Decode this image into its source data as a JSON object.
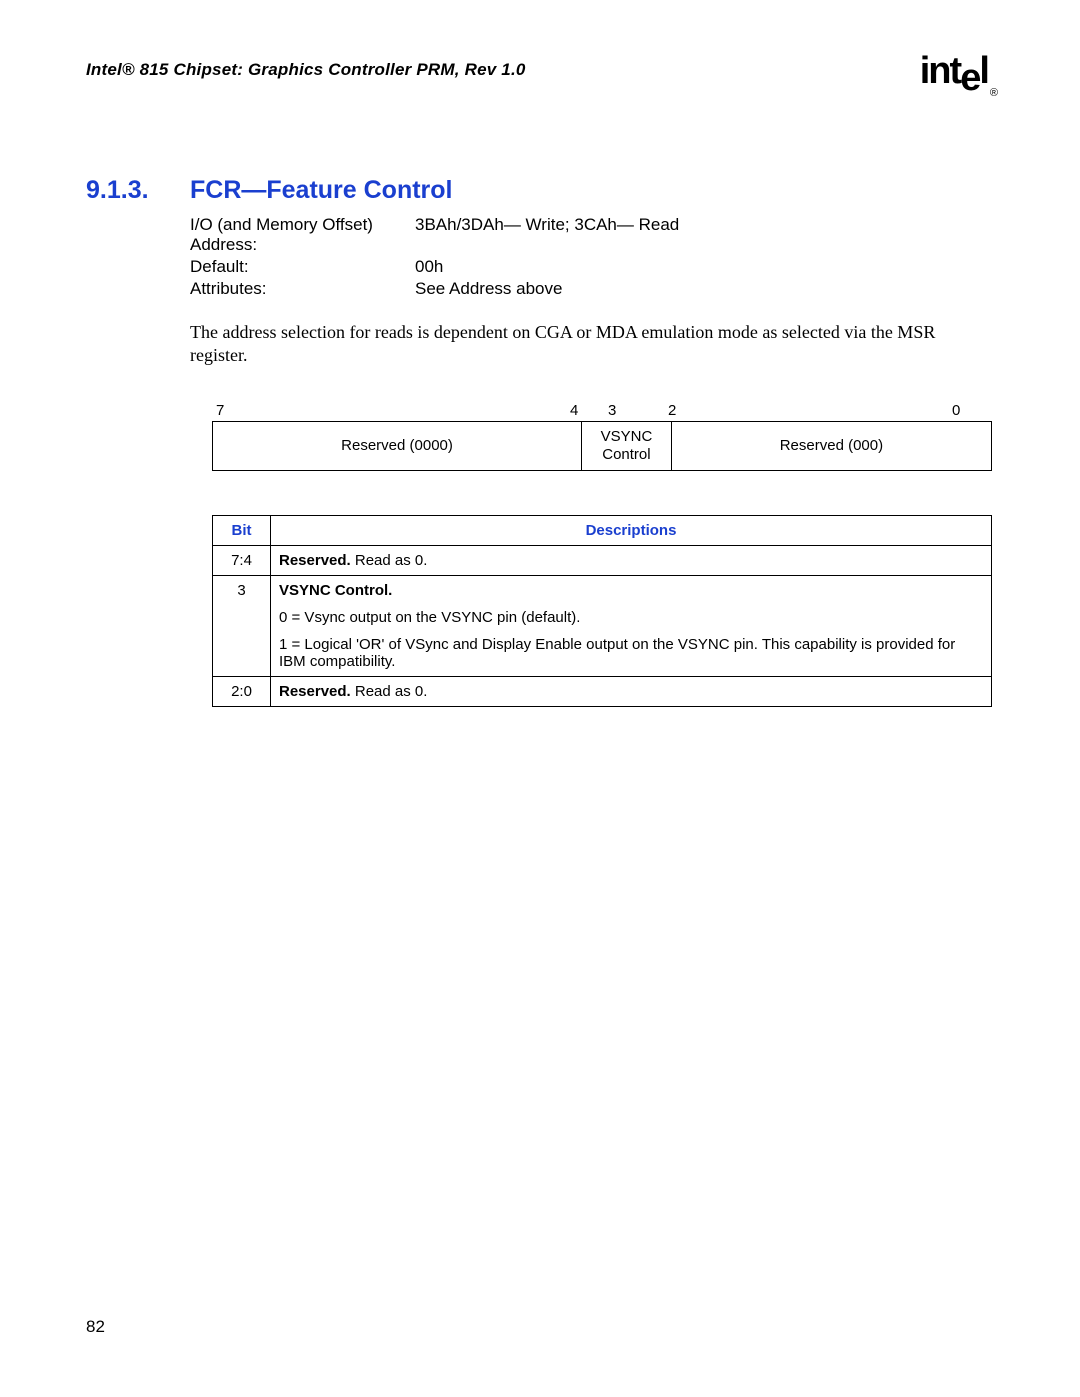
{
  "header": {
    "running": "Intel® 815 Chipset: Graphics Controller PRM, Rev 1.0",
    "logo_text": "intel",
    "logo_reg": "®"
  },
  "section": {
    "number": "9.1.3.",
    "title": "FCR—Feature Control"
  },
  "spec": {
    "addr_label": "I/O (and Memory Offset) Address:",
    "addr_value": "3BAh/3DAh— Write;  3CAh— Read",
    "default_label": "Default:",
    "default_value": "00h",
    "attributes_label": "Attributes:",
    "attributes_value": "See Address above"
  },
  "body": {
    "para1": "The address selection for reads is dependent on CGA or MDA emulation mode as selected via the MSR register."
  },
  "bits": {
    "b7": "7",
    "b4": "4",
    "b3": "3",
    "b2": "2",
    "b0": "0",
    "field_a": "Reserved (0000)",
    "field_b_line1": "VSYNC",
    "field_b_line2": "Control",
    "field_c": "Reserved (000)"
  },
  "desc": {
    "header_bit": "Bit",
    "header_desc": "Descriptions",
    "rows": [
      {
        "bit": "7:4",
        "html": "<span class=\"bold\">Reserved.</span> Read as 0."
      },
      {
        "bit": "3",
        "html": "<p><span class=\"bold\">VSYNC Control.</span></p><p>0 = Vsync output on the VSYNC pin (default).</p><p>1 = Logical 'OR' of VSync and Display Enable output on the VSYNC pin. This capability is provided for IBM compatibility.</p>"
      },
      {
        "bit": "2:0",
        "html": "<span class=\"bold\">Reserved.</span> Read as 0."
      }
    ]
  },
  "page_number": "82"
}
